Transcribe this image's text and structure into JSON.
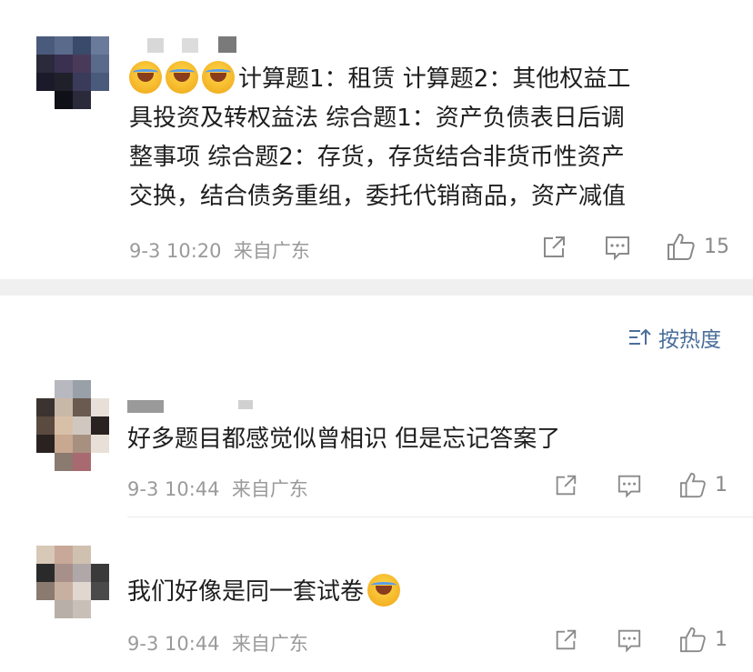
{
  "sort": {
    "label": "按热度",
    "icon": "sort-icon"
  },
  "main_post": {
    "content": "计算题1：租赁 计算题2：其他权益工具投资及转权益法  综合题1：资产负债表日后调整事项 综合题2：存货，存货结合非货币性资产交换，结合债务重组，委托代销商品，资产减值",
    "line1": "计算题1：租赁 计算题2：其他权益工",
    "line2": "具投资及转权益法  综合题1：资产负债表日后调",
    "line3": "整事项 综合题2：存货，存货结合非货币性资产",
    "line4": "交换，结合债务重组，委托代销商品，资产减值",
    "time": "9-3 10:20",
    "source": "来自广东",
    "likes": "15",
    "emoji": "crying-laughing-emoji"
  },
  "comments": [
    {
      "content": "好多题目都感觉似曾相识  但是忘记答案了",
      "time": "9-3 10:44",
      "source": "来自广东",
      "likes": "1"
    },
    {
      "content": "我们好像是同一套试卷",
      "time": "9-3 10:44",
      "source": "来自广东",
      "likes": "1",
      "emoji": "crying-laughing-emoji"
    }
  ],
  "icons": {
    "share": "share-icon",
    "comment": "comment-icon",
    "like": "thumbs-up-icon"
  },
  "colors": {
    "meta": "#9a9a9a",
    "sort": "#4a6e9a",
    "divider": "#f0f0f0"
  }
}
